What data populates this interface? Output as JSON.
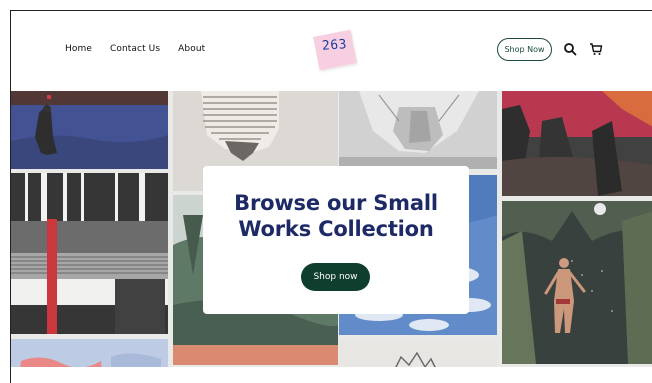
{
  "nav": {
    "items": [
      {
        "label": "Home"
      },
      {
        "label": "Contact Us"
      },
      {
        "label": "About"
      }
    ]
  },
  "logo": {
    "text": "263"
  },
  "header": {
    "shop_now_label": "Shop Now"
  },
  "icons": {
    "search": "search-icon",
    "cart": "cart-icon"
  },
  "hero": {
    "title": "Browse our Small Works Collection",
    "button_label": "Shop now"
  },
  "colors": {
    "brand_green": "#0f3d2e",
    "title_navy": "#1d2a66",
    "logo_pink": "#f8cfe0",
    "logo_blue": "#1c3fa3"
  }
}
